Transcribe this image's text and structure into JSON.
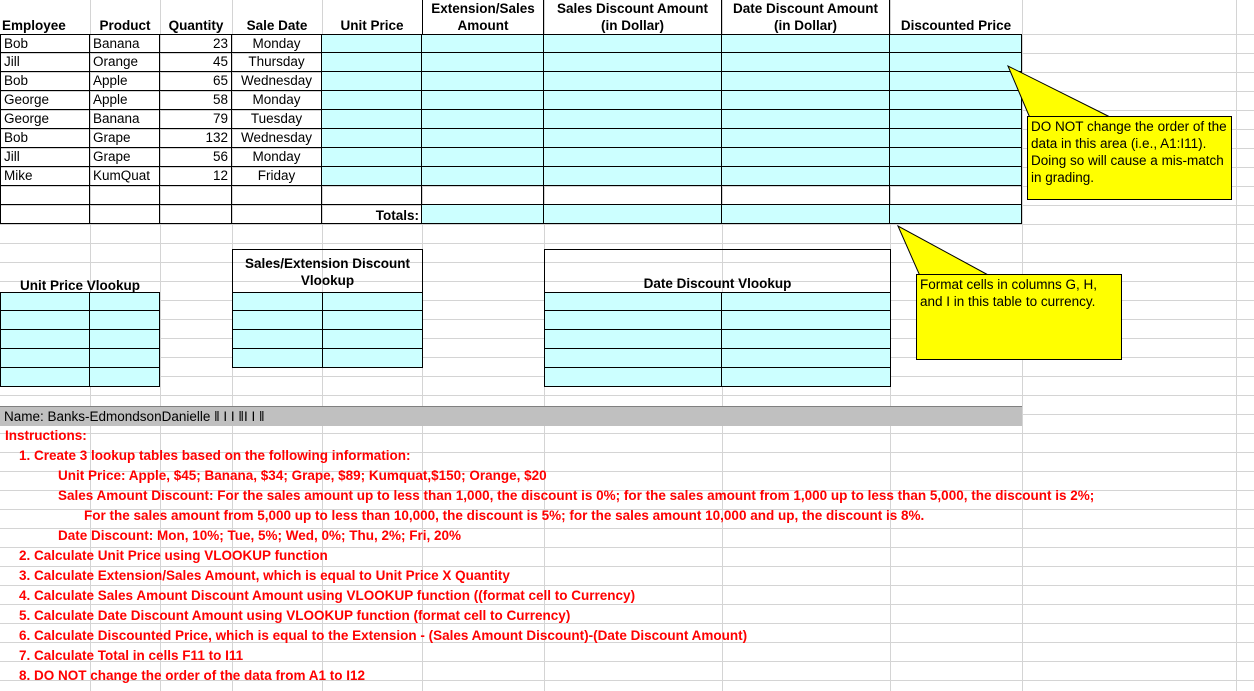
{
  "headers": {
    "employee": "Employee",
    "product": "Product",
    "quantity": "Quantity",
    "sale_date": "Sale Date",
    "unit_price": "Unit Price",
    "extension": "Extension/Sales\nAmount",
    "sales_discount": "Sales Discount Amount\n(in Dollar)",
    "date_discount": "Date Discount Amount\n(in Dollar)",
    "discounted_price": "Discounted Price"
  },
  "rows": [
    {
      "employee": "Bob",
      "product": "Banana",
      "quantity": "23",
      "day": "Monday"
    },
    {
      "employee": "Jill",
      "product": "Orange",
      "quantity": "45",
      "day": "Thursday"
    },
    {
      "employee": "Bob",
      "product": "Apple",
      "quantity": "65",
      "day": "Wednesday"
    },
    {
      "employee": "George",
      "product": "Apple",
      "quantity": "58",
      "day": "Monday"
    },
    {
      "employee": "George",
      "product": "Banana",
      "quantity": "79",
      "day": "Tuesday"
    },
    {
      "employee": "Bob",
      "product": "Grape",
      "quantity": "132",
      "day": "Wednesday"
    },
    {
      "employee": "Jill",
      "product": "Grape",
      "quantity": "56",
      "day": "Monday"
    },
    {
      "employee": "Mike",
      "product": "KumQuat",
      "quantity": "12",
      "day": "Friday"
    }
  ],
  "totals_label": "Totals:",
  "notes": {
    "order": "DO NOT change the order of the data in this area (i.e., A1:I11). Doing so will cause a mis-match in grading.",
    "format": "Format cells in columns G, H, and I in this table to currency."
  },
  "lookups": {
    "unit_price": "Unit Price Vlookup",
    "sales_ext": "Sales/Extension Discount\nVlookup",
    "date": "Date Discount Vlookup"
  },
  "name_bar": "Name:  Banks-EdmondsonDanielle  ‖ I  I ‖I  I  ‖",
  "instructions": {
    "title": "Instructions:",
    "l1": "1. Create 3 lookup tables based on the following information:",
    "l1a": "Unit Price:  Apple, $45;  Banana, $34;  Grape, $89;  Kumquat,$150; Orange, $20",
    "l1b": "Sales Amount Discount: For the sales amount up to less than 1,000, the discount is 0%; for the sales amount from 1,000 up to less than 5,000, the discount is 2%;",
    "l1c": "For the sales amount from 5,000 up to less than 10,000, the discount is 5%; for the sales amount 10,000 and up, the discount is 8%.",
    "l1d": "Date Discount: Mon, 10%;  Tue, 5%;  Wed, 0%;  Thu, 2%;  Fri, 20%",
    "l2": "2. Calculate Unit Price using VLOOKUP function",
    "l3": "3. Calculate Extension/Sales Amount, which is equal to Unit Price X Quantity",
    "l4": "4. Calculate Sales Amount Discount Amount using VLOOKUP function ((format cell to Currency)",
    "l5": "5. Calculate Date Discount Amount using VLOOKUP function (format cell to Currency)",
    "l6": "6. Calculate Discounted Price, which is equal to the Extension - (Sales Amount Discount)-(Date Discount Amount)",
    "l7": "7. Calculate Total in cells F11 to I11",
    "l8": "8. DO NOT change the order of the data from A1 to I12"
  },
  "colors": {
    "cyan": "#ccffff",
    "note": "#ffff00",
    "red": "#ff0000",
    "namebar": "#c0c0c0"
  }
}
